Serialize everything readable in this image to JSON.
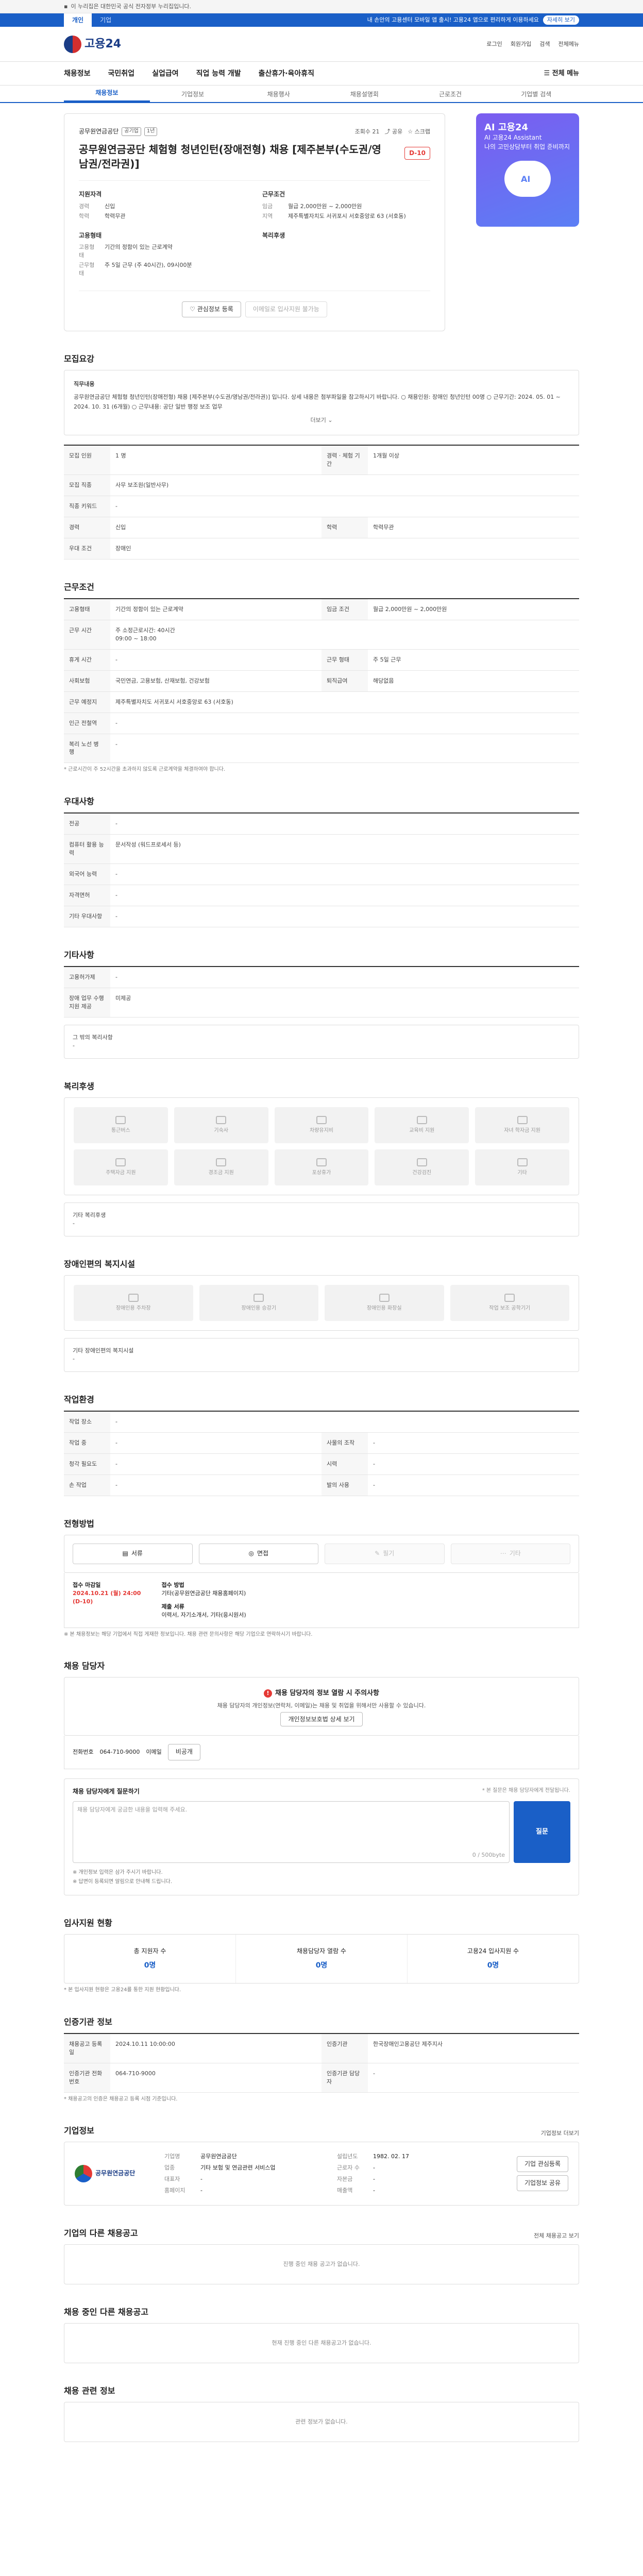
{
  "topbar": {
    "notice": "이 누리집은 대한민국 공식 전자정부 누리집입니다."
  },
  "site_tabs": {
    "items": [
      "개인",
      "기업"
    ],
    "banner": "내 손안의 고용센터 모바일 앱 출시! 고용24 앱으로 편리하게 이용하세요",
    "banner_btn": "자세히 보기"
  },
  "header": {
    "logo": "고용24",
    "util": [
      "로그인",
      "회원가입",
      "검색",
      "전체메뉴"
    ]
  },
  "gnb": {
    "items": [
      "채용정보",
      "국민취업",
      "실업급여",
      "직업 능력 개발",
      "출산휴가·육아휴직"
    ],
    "all": "전체 메뉴"
  },
  "subnav": {
    "items": [
      "채용정보",
      "기업정보",
      "채용행사",
      "채용설명회",
      "근로조건",
      "기업별 검색"
    ]
  },
  "job": {
    "company": "공무원연금공단",
    "badges": [
      "공기업",
      "1년"
    ],
    "views": "조회수 21",
    "share": "공유",
    "scrap": "스크랩",
    "title": "공무원연금공단 체험형 청년인턴(장애전형) 채용 [제주본부(수도권/영남권/전라권)]",
    "dday": "D-10",
    "conditions_title": "지원자격",
    "conditions": [
      [
        "경력",
        "신입"
      ],
      [
        "학력",
        "학력무관"
      ]
    ],
    "work_title": "근무조건",
    "work": [
      [
        "임금",
        "월급 2,000만원 ~ 2,000만원"
      ],
      [
        "지역",
        "제주특별자치도 서귀포시 서호중앙로 63 (서호동)"
      ]
    ],
    "hire_title": "고용형태",
    "hire": [
      [
        "고용형태",
        "기간의 정함이 있는 근로계약"
      ],
      [
        "근무형태",
        "주 5일 근무 (주 40시간), 09시00분"
      ]
    ],
    "benefit_title": "복리후생",
    "btn_scrap": "관심정보 등록",
    "btn_apply": "이메일로 입사지원 불가능"
  },
  "side": {
    "line1": "AI 고용24",
    "line2": "AI 고용24 Assistant",
    "line3": "나의 고민상담부터 취업 준비까지"
  },
  "sec_recruit": {
    "title": "모집요강",
    "desc_title": "직무내용",
    "desc": "공무원연금공단 체험형 청년인턴(장애전형) 채용 [제주본부(수도권/영남권/전라권)] 입니다. 상세 내용은 첨부파일을 참고하시기 바랍니다. ○ 채용인원: 장애인 청년인턴 00명 ○ 근무기간: 2024. 05. 01 ~ 2024. 10. 31 (6개월) ○ 근무내용: 공단 일반 행정 보조 업무",
    "more": "더보기",
    "rows": [
      [
        "모집 인원",
        "1 명",
        "경력 · 체험 기간",
        "1개월 이상"
      ],
      [
        "모집 직종",
        "사무 보조원(일반사무)",
        "",
        ""
      ],
      [
        "직종 키워드",
        "-",
        "",
        ""
      ],
      [
        "경력",
        "신입",
        "학력",
        "학력무관"
      ],
      [
        "우대 조건",
        "장애인",
        "",
        ""
      ]
    ]
  },
  "sec_work": {
    "title": "근무조건",
    "rows": [
      [
        "고용형태",
        "기간의 정함이 있는 근로계약",
        "임금 조건",
        "월급 2,000만원 ~ 2,000만원"
      ],
      [
        "근무 시간",
        "주 소정근로시간: 40시간\n09:00 ~ 18:00",
        "",
        ""
      ],
      [
        "휴게 시간",
        "-",
        "근무 형태",
        "주 5일 근무"
      ],
      [
        "사회보험",
        "국민연금, 고용보험, 산재보험, 건강보험",
        "퇴직급여",
        "해당없음"
      ],
      [
        "근무 예정지",
        "제주특별자치도 서귀포시 서호중앙로 63 (서호동)",
        "",
        ""
      ],
      [
        "인근 전철역",
        "-",
        "",
        ""
      ],
      [
        "복리 노선 병 행",
        "-",
        "",
        ""
      ]
    ],
    "note": "* 근로시간이 주 52시간을 초과하지 않도록 근로계약을 체결하여야 합니다."
  },
  "sec_prefer": {
    "title": "우대사항",
    "rows": [
      [
        "전공",
        "-"
      ],
      [
        "컴퓨터 활용 능력",
        "문서작성 (워드프로세서 등)"
      ],
      [
        "외국어 능력",
        "-"
      ],
      [
        "자격면허",
        "-"
      ],
      [
        "기타 우대사항",
        "-"
      ]
    ]
  },
  "sec_extra": {
    "title": "기타사항",
    "rows": [
      [
        "고용허가제",
        "-"
      ],
      [
        "장애 업무 수행 지원 제공",
        "미제공"
      ]
    ],
    "plain_label": "그 밖의 복리사항",
    "plain_value": "-"
  },
  "sec_welfare": {
    "title": "복리후생",
    "cards": [
      "통근버스",
      "기숙사",
      "차량유지비",
      "교육비 지원",
      "자녀 학자금 지원",
      "주택자금 지원",
      "경조금 지원",
      "포상휴가",
      "건강검진",
      "기타"
    ],
    "plain_label": "기타 복리후생",
    "plain_value": "-"
  },
  "sec_disability": {
    "title": "장애인편의 복지시설",
    "cards": [
      "장애인용 주차장",
      "장애인용 승강기",
      "장애인용 화장실",
      "작업 보조 공학기기"
    ],
    "plain_label": "기타 장애인편의 복지시설",
    "plain_value": "-"
  },
  "sec_env": {
    "title": "작업환경",
    "rows": [
      [
        "작업 장소",
        "-",
        "",
        ""
      ],
      [
        "작업 중",
        "-",
        "사물의 조작",
        "-"
      ],
      [
        "청각 필요도",
        "-",
        "시력",
        "-"
      ],
      [
        "손 작업",
        "-",
        "발의 사용",
        "-"
      ]
    ]
  },
  "sec_method": {
    "title": "전형방법",
    "buttons": [
      "서류",
      "면접",
      "필기",
      "기타"
    ],
    "period_label": "접수 마감일",
    "period_value": "2024.10.21 (월) 24:00",
    "period_sub": "(D-10)",
    "method_label": "접수 방법",
    "method_value": "기타(공무원연금공단 채용홈페이지)",
    "docs_label": "제출 서류",
    "docs_value": "이력서, 자기소개서, 기타(응시원서)",
    "note": "※ 본 채용정보는 해당 기업에서 직접 게재한 정보입니다. 채용 관련 문의사항은 해당 기업으로 연락하시기 바랍니다."
  },
  "sec_contact": {
    "title": "채용 담당자",
    "warn_title": "채용 담당자의 정보 열람 시 주의사항",
    "warn_body": "채용 담당자의 개인정보(연락처, 이메일)는 채용 및 취업을 위해서만 사용할 수 있습니다.",
    "warn_btn": "개인정보보호법 상세 보기",
    "phone_label": "전화번호",
    "phone": "064-710-9000",
    "email_label": "이메일",
    "email": "비공개",
    "q_title": "채용 담당자에게 질문하기",
    "q_hint": "* 본 질문은 채용 담당자에게 전달됩니다.",
    "q_placeholder": "채용 담당자에게 궁금한 내용을 입력해 주세요.",
    "q_count": "0 / 500byte",
    "q_btn": "질문",
    "q_notes": [
      "※ 개인정보 입력은 삼가 주시기 바랍니다.",
      "※ 답변이 등록되면 알림으로 안내해 드립니다."
    ]
  },
  "sec_stats": {
    "title": "입사지원 현황",
    "items": [
      [
        "총 지원자 수",
        "0명"
      ],
      [
        "채용담당자 열람 수",
        "0명"
      ],
      [
        "고용24 입사지원 수",
        "0명"
      ]
    ],
    "note": "* 본 입사지원 현황은 고용24를 통한 지원 현황입니다."
  },
  "sec_agency": {
    "title": "인증기관 정보",
    "rows": [
      [
        "채용공고 등록일",
        "2024.10.11 10:00:00",
        "인증기관",
        "한국장애인고용공단 제주지사"
      ],
      [
        "인증기관 전화번호",
        "064-710-9000",
        "인증기관 담당자",
        "-"
      ]
    ],
    "note": "* 채용공고의 인증은 채용공고 등록 시점 기준입니다."
  },
  "sec_company": {
    "title": "기업정보",
    "link": "기업정보 더보기",
    "logo": "공무원연금공단",
    "info": [
      [
        "기업명",
        "공무원연금공단",
        "설립년도",
        "1982. 02. 17"
      ],
      [
        "업종",
        "기타 보험 및 연금관련 서비스업",
        "근로자 수",
        "-"
      ],
      [
        "대표자",
        "-",
        "자본금",
        "-"
      ],
      [
        "홈페이지",
        "-",
        "매출액",
        "-"
      ]
    ],
    "btns": [
      "기업 관심등록",
      "기업정보 공유"
    ]
  },
  "sec_other": {
    "title": "기업의 다른 채용공고",
    "empty": "진행 중인 채용 공고가 없습니다.",
    "hint": "전체 채용공고 보기"
  },
  "sec_nearby": {
    "title": "채용 중인 다른 채용공고",
    "empty": "현재 진행 중인 다른 채용공고가 없습니다."
  },
  "sec_apply_history": {
    "title": "채용 관련 정보",
    "empty": "관련 정보가 없습니다."
  }
}
